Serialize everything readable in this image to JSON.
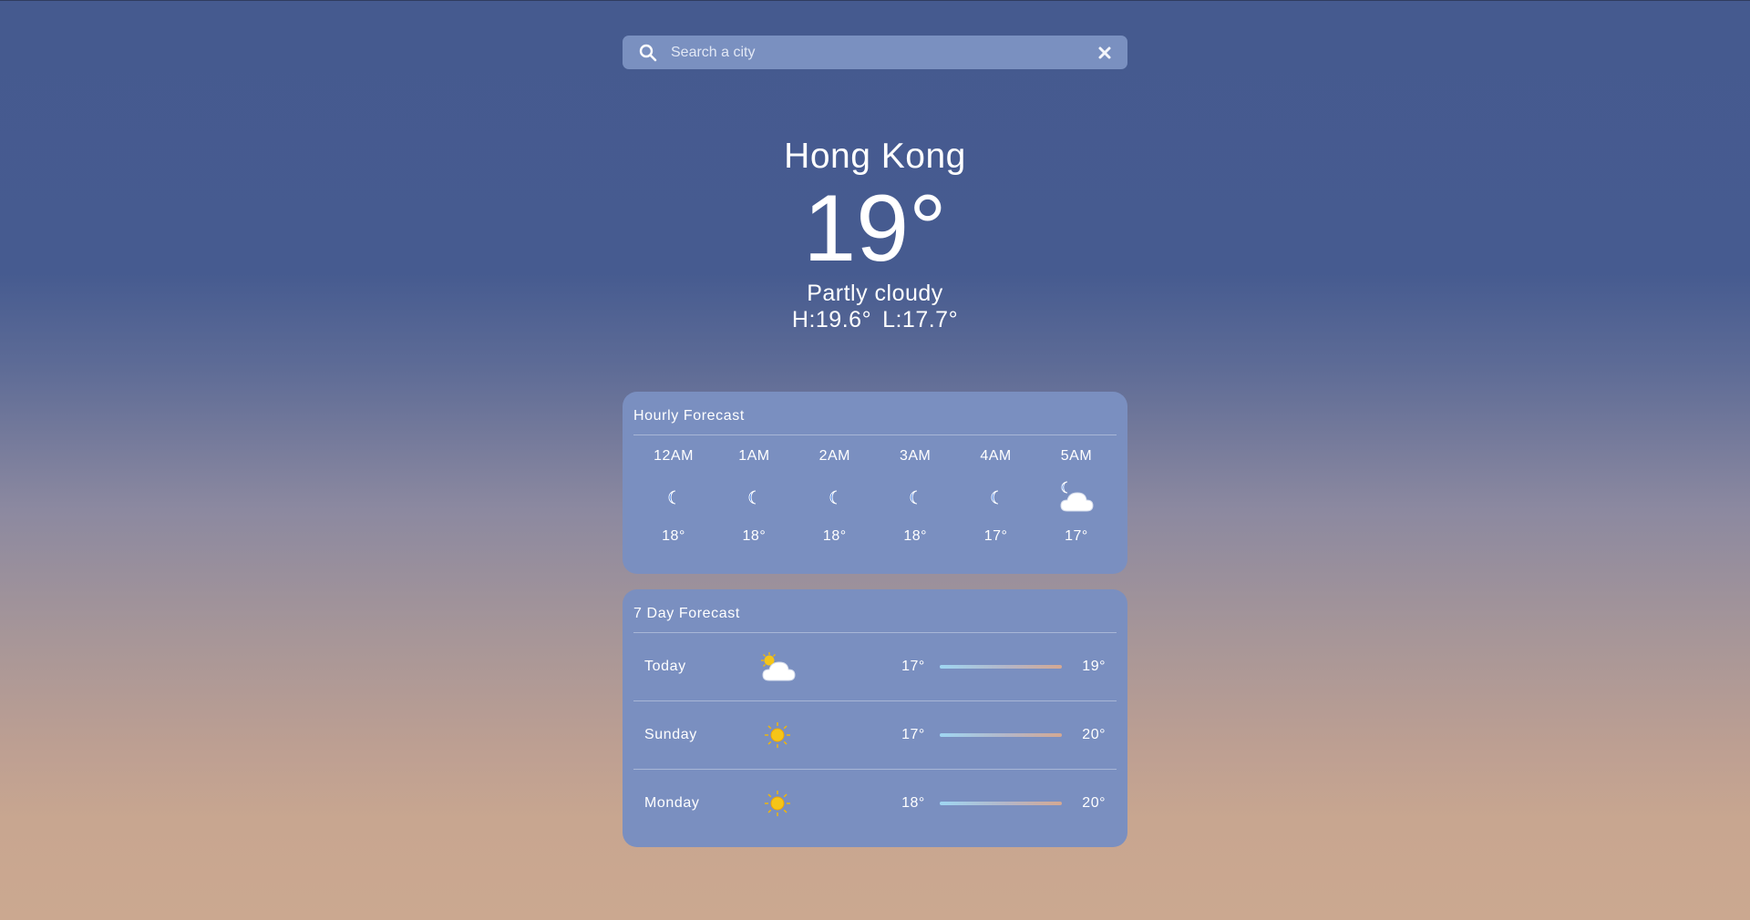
{
  "search": {
    "placeholder": "Search a city",
    "icon": "search-icon",
    "clear_icon": "close-icon"
  },
  "current": {
    "city": "Hong Kong",
    "temperature": "19°",
    "condition": "Partly cloudy",
    "high": "H:19.6°",
    "low": "L:17.7°"
  },
  "hourly": {
    "title": "Hourly Forecast",
    "items": [
      {
        "time": "12AM",
        "icon": "moon-icon",
        "temp": "18°"
      },
      {
        "time": "1AM",
        "icon": "moon-icon",
        "temp": "18°"
      },
      {
        "time": "2AM",
        "icon": "moon-icon",
        "temp": "18°"
      },
      {
        "time": "3AM",
        "icon": "moon-icon",
        "temp": "18°"
      },
      {
        "time": "4AM",
        "icon": "moon-icon",
        "temp": "17°"
      },
      {
        "time": "5AM",
        "icon": "moon-cloud-icon",
        "temp": "17°"
      }
    ]
  },
  "daily": {
    "title": "7 Day Forecast",
    "items": [
      {
        "day": "Today",
        "icon": "sun-cloud-icon",
        "low": "17°",
        "high": "19°"
      },
      {
        "day": "Sunday",
        "icon": "sun-icon",
        "low": "17°",
        "high": "20°"
      },
      {
        "day": "Monday",
        "icon": "sun-icon",
        "low": "18°",
        "high": "20°"
      }
    ]
  },
  "colors": {
    "card": "#7a8fc0",
    "sky_top": "#455a8f",
    "sky_bottom": "#cba890",
    "sun": "#f5c518",
    "moon": "#2b6fe0"
  }
}
